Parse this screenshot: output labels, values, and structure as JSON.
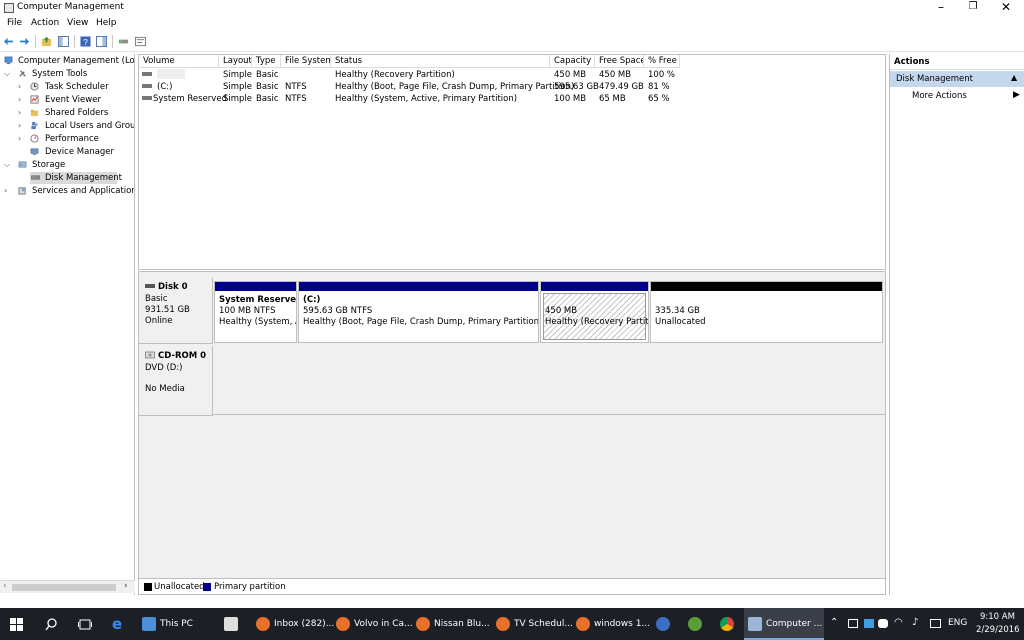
{
  "window": {
    "title": "Computer Management",
    "minimize": "–",
    "restore": "❐",
    "close": "✕"
  },
  "menu": [
    "File",
    "Action",
    "View",
    "Help"
  ],
  "tree": {
    "root": "Computer Management (Local",
    "system_tools": "System Tools",
    "task_scheduler": "Task Scheduler",
    "event_viewer": "Event Viewer",
    "shared_folders": "Shared Folders",
    "local_users": "Local Users and Groups",
    "performance": "Performance",
    "device_manager": "Device Manager",
    "storage": "Storage",
    "disk_management": "Disk Management",
    "services_apps": "Services and Applications"
  },
  "volumes": {
    "headers": [
      "Volume",
      "Layout",
      "Type",
      "File System",
      "Status",
      "Capacity",
      "Free Space",
      "% Free"
    ],
    "rows": [
      {
        "volume": "",
        "layout": "Simple",
        "type": "Basic",
        "fs": "",
        "status": "Healthy (Recovery Partition)",
        "capacity": "450 MB",
        "free": "450 MB",
        "pct": "100 %"
      },
      {
        "volume": "(C:)",
        "layout": "Simple",
        "type": "Basic",
        "fs": "NTFS",
        "status": "Healthy (Boot, Page File, Crash Dump, Primary Partition)",
        "capacity": "595.63 GB",
        "free": "479.49 GB",
        "pct": "81 %"
      },
      {
        "volume": "System Reserved",
        "layout": "Simple",
        "type": "Basic",
        "fs": "NTFS",
        "status": "Healthy (System, Active, Primary Partition)",
        "capacity": "100 MB",
        "free": "65 MB",
        "pct": "65 %"
      }
    ]
  },
  "disk0": {
    "name": "Disk 0",
    "type": "Basic",
    "size": "931.51 GB",
    "state": "Online",
    "partitions": [
      {
        "title": "System Reserved",
        "line1": "100 MB NTFS",
        "line2": "Healthy (System, Ac"
      },
      {
        "title": "(C:)",
        "line1": "595.63 GB NTFS",
        "line2": "Healthy (Boot, Page File, Crash Dump, Primary Partition)"
      },
      {
        "title": "",
        "line1": "450 MB",
        "line2": "Healthy (Recovery Partition"
      },
      {
        "title": "",
        "line1": "335.34 GB",
        "line2": "Unallocated"
      }
    ]
  },
  "cdrom": {
    "name": "CD-ROM 0",
    "drive": "DVD (D:)",
    "state": "No Media"
  },
  "legend": {
    "unallocated": "Unallocated",
    "primary": "Primary partition"
  },
  "actions": {
    "header": "Actions",
    "section": "Disk Management",
    "more": "More Actions"
  },
  "taskbar": {
    "items": [
      "This PC",
      "Inbox (282)...",
      "Volvo in Ca...",
      "Nissan Blu...",
      "TV Schedul...",
      "windows 1...",
      "Computer ..."
    ],
    "lang": "ENG",
    "time": "9:10 AM",
    "date": "2/29/2016"
  },
  "colors": {
    "primary_partition": "#00008b",
    "unallocated": "#000000",
    "selection": "#d9d9d9",
    "actions_header": "#c4d7ec",
    "taskbar": "#1c1f26"
  }
}
